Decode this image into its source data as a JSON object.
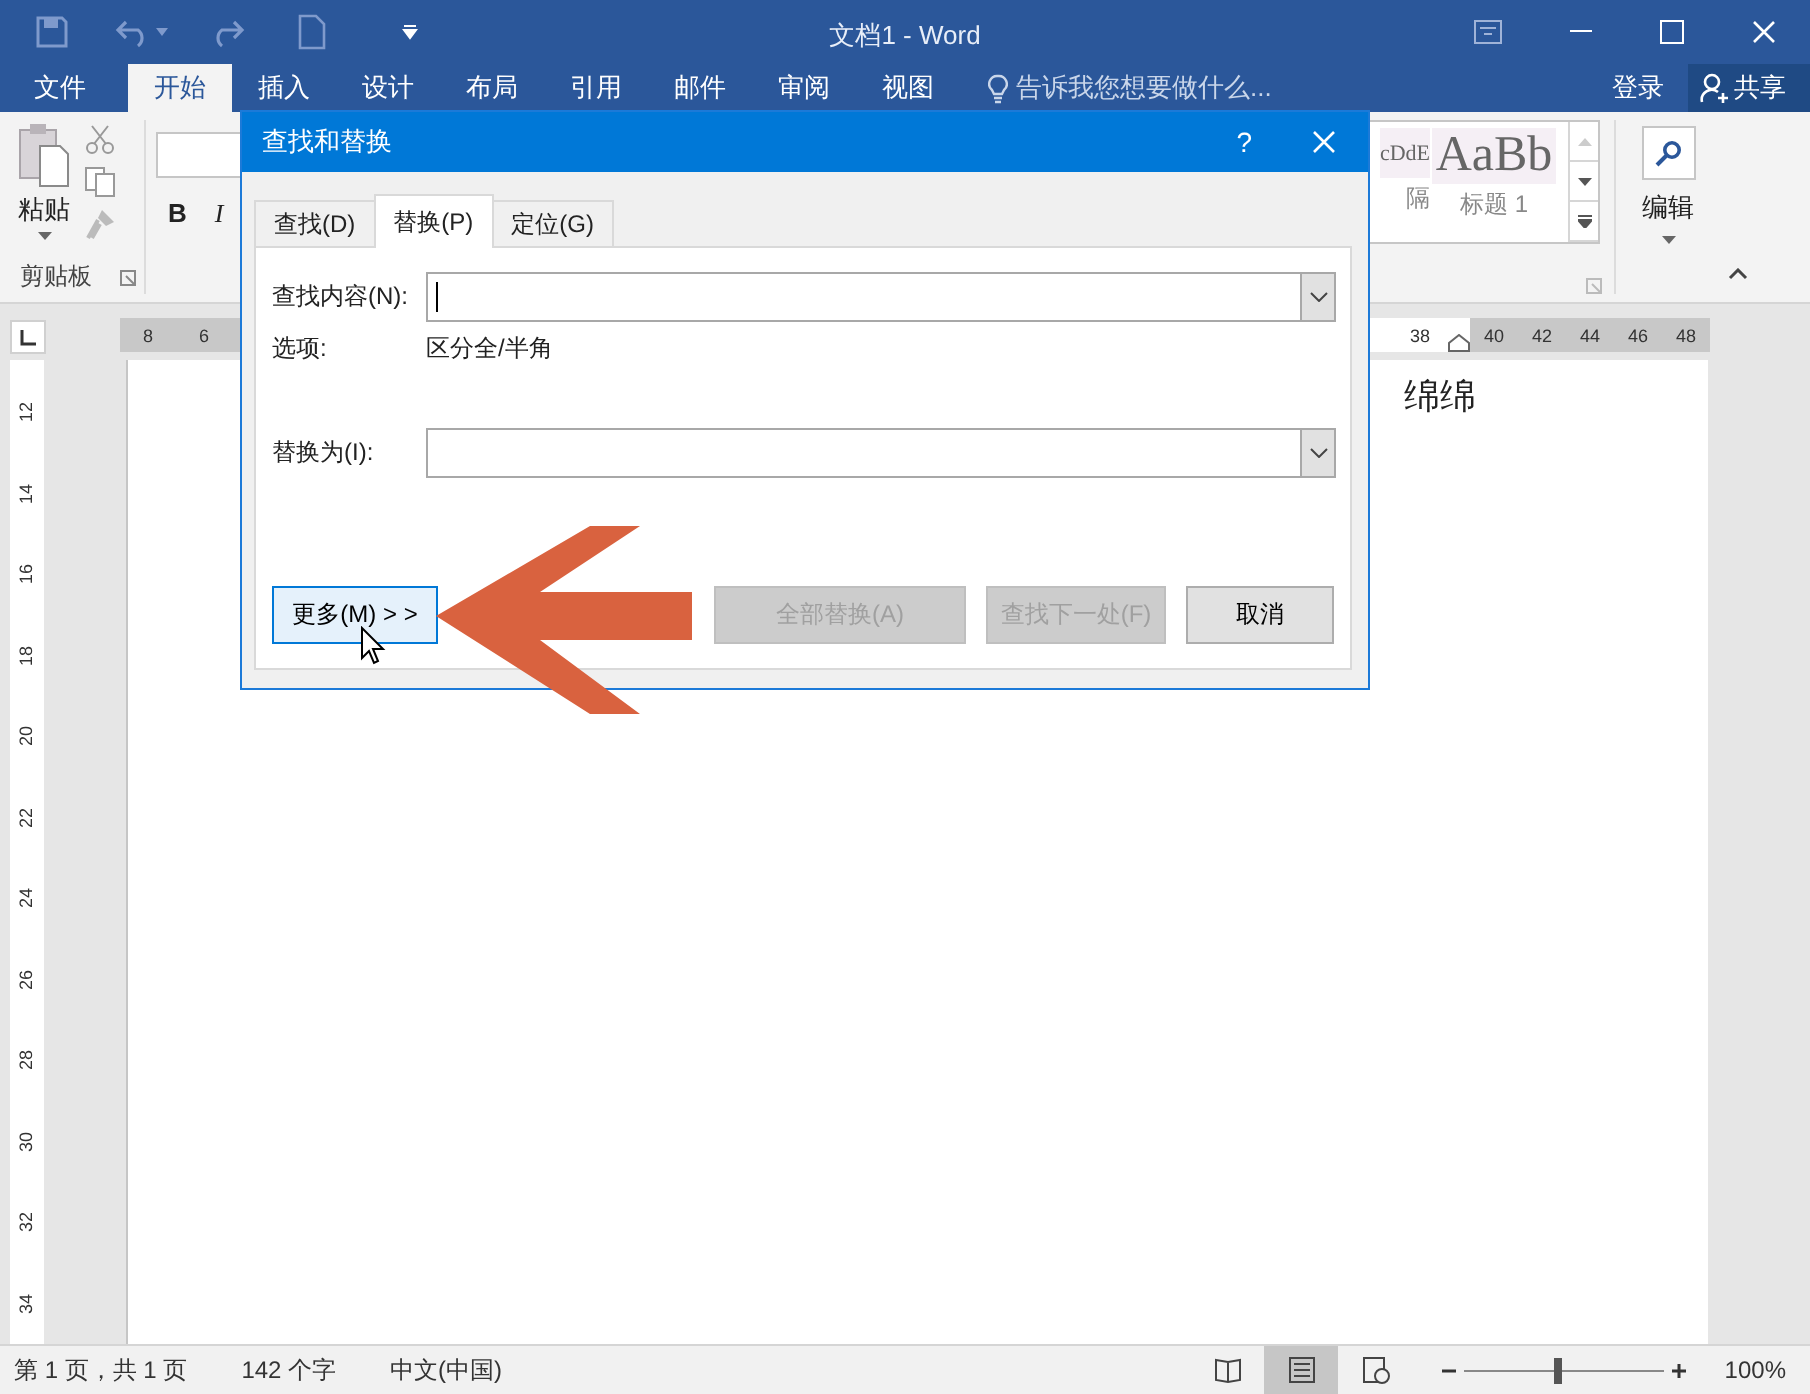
{
  "window": {
    "title": "文档1 - Word"
  },
  "ribbon_tabs": [
    {
      "label": "文件",
      "selected": false
    },
    {
      "label": "开始",
      "selected": true
    },
    {
      "label": "插入",
      "selected": false
    },
    {
      "label": "设计",
      "selected": false
    },
    {
      "label": "布局",
      "selected": false
    },
    {
      "label": "引用",
      "selected": false
    },
    {
      "label": "邮件",
      "selected": false
    },
    {
      "label": "审阅",
      "selected": false
    },
    {
      "label": "视图",
      "selected": false
    }
  ],
  "tell_me": {
    "placeholder": "告诉我您想要做什么..."
  },
  "account": {
    "sign_in": "登录",
    "share": "共享"
  },
  "ribbon": {
    "paste": "粘贴",
    "clipboard_group": "剪贴板",
    "bold": "B",
    "italic": "I",
    "styles": [
      {
        "sample": "cDdE",
        "name": "隔"
      },
      {
        "sample": "AaBb",
        "name": "标题 1"
      }
    ],
    "editing": "编辑"
  },
  "ruler": {
    "left_ticks": [
      "8",
      "6"
    ],
    "middle_ticks": [
      "38"
    ],
    "right_ticks": [
      "40",
      "42",
      "44",
      "46",
      "48"
    ]
  },
  "vertical_ruler": [
    "12",
    "14",
    "16",
    "18",
    "20",
    "22",
    "24",
    "26",
    "28",
    "30",
    "32",
    "34"
  ],
  "document": {
    "text": "绵绵"
  },
  "dialog": {
    "title": "查找和替换",
    "help": "?",
    "tabs": [
      {
        "label": "查找(D)",
        "selected": false
      },
      {
        "label": "替换(P)",
        "selected": true
      },
      {
        "label": "定位(G)",
        "selected": false
      }
    ],
    "find_label": "查找内容(N):",
    "options_label": "选项:",
    "options_value": "区分全/半角",
    "replace_label": "替换为(I):",
    "buttons": [
      {
        "label": "更多(M) > >",
        "disabled": false,
        "focused": true
      },
      {
        "label": "全部替换(A)",
        "disabled": true,
        "focused": false
      },
      {
        "label": "查找下一处(F)",
        "disabled": true,
        "focused": false
      },
      {
        "label": "取消",
        "disabled": false,
        "focused": false
      }
    ]
  },
  "status_bar": {
    "page": "第 1 页，共 1 页",
    "words": "142 个字",
    "language": "中文(中国)",
    "views": [
      {
        "kind": "read",
        "selected": false
      },
      {
        "kind": "print",
        "selected": true
      },
      {
        "kind": "web",
        "selected": false
      }
    ],
    "zoom": {
      "level": 0.47,
      "reading": "100%"
    }
  }
}
